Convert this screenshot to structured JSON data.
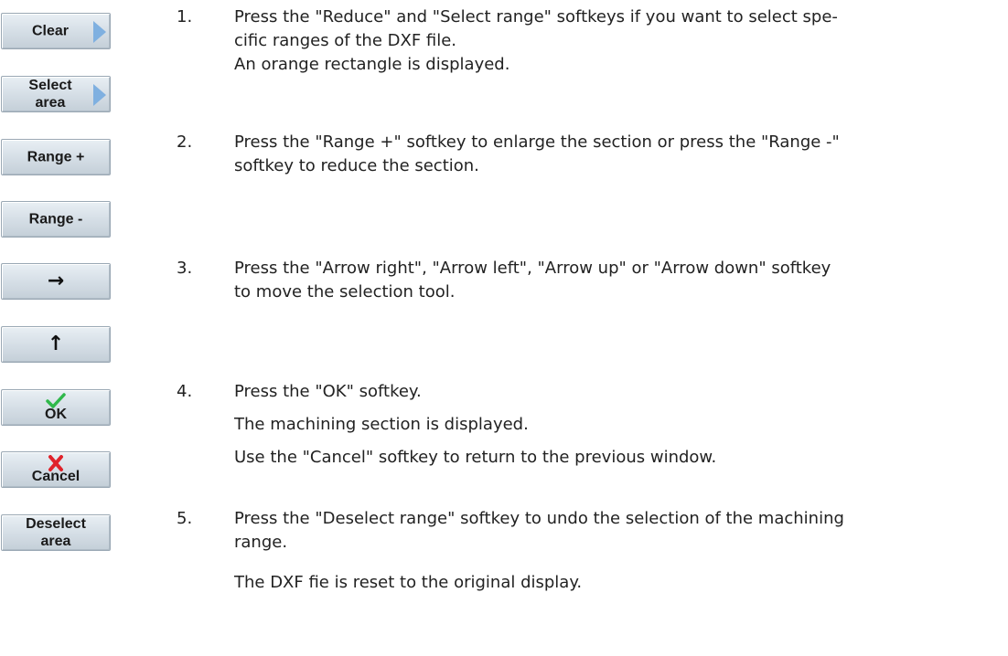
{
  "softkeys": {
    "clear": "Clear",
    "select_area": "Select\narea",
    "range_plus": "Range +",
    "range_minus": "Range -",
    "arrow_right": "→",
    "arrow_up": "↑",
    "ok": "OK",
    "cancel": "Cancel",
    "deselect_area": "Deselect\narea"
  },
  "steps": [
    {
      "number": "1.",
      "text": "Press the \"Reduce\" and \"Select range\" softkeys if you want to select spe-\ncific ranges of the DXF file.",
      "result": "An orange rectangle is displayed."
    },
    {
      "number": "2.",
      "text": "Press the \"Range +\" softkey to enlarge the section or press the \"Range -\"\nsoftkey to reduce the section."
    },
    {
      "number": "3.",
      "text": "Press the \"Arrow right\", \"Arrow left\", \"Arrow up\" or \"Arrow down\" softkey\nto move the selection tool."
    },
    {
      "number": "4.",
      "text": "Press the \"OK\" softkey.",
      "result": "The machining section is displayed.",
      "note": "Use the \"Cancel\" softkey to return to the previous window."
    },
    {
      "number": "5.",
      "text": "Press the \"Deselect range\" softkey to undo the selection of the machining\nrange.",
      "result": "The DXF fie is reset to the original display."
    }
  ],
  "colors": {
    "ok_check": "#2fb84a",
    "cancel_x": "#e0222a",
    "softkey_arrow": "#7fb0e0"
  }
}
